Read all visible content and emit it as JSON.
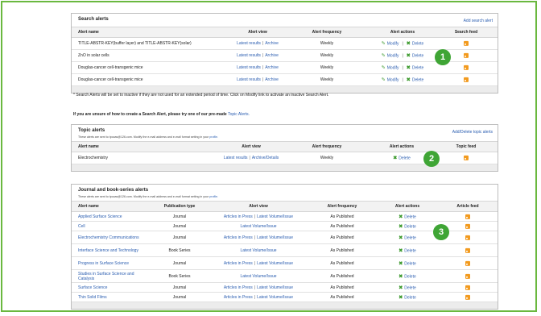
{
  "search_alerts": {
    "title": "Search alerts",
    "add_link": "Add search alert",
    "columns": [
      "Alert name",
      "Alert view",
      "Alert frequency",
      "Alert actions",
      "Search feed"
    ],
    "rows": [
      {
        "name": "TITLE-ABSTR-KEY(buffer layer) and TITLE-ABSTR-KEY(solar)",
        "frequency": "Weekly"
      },
      {
        "name": "ZnO in solar cells",
        "frequency": "Weekly"
      },
      {
        "name": "Douglas-cancer cell-transgenic mice",
        "frequency": "Weekly"
      },
      {
        "name": "Douglas-cancer cell-transgenic mice",
        "frequency": "Weekly"
      }
    ],
    "view_latest": "Latest results",
    "view_archive": "Archive",
    "modify": "Modify",
    "delete": "Delete",
    "sep": "|"
  },
  "notes": {
    "inactive": "* Search Alerts will be set to inactive if they are not used for an extended period of time. Click on Modify link to activate an Inactive Search Alert.",
    "unsure": "If you are unsure of how to create a Search Alert, please try one of our pre-made",
    "unsure_link": "Topic Alerts."
  },
  "topic_alerts": {
    "title": "Topic alerts",
    "subtitle": "These alerts are sent to tpocas@126.com. Modify the e-mail address and e-mail format setting in your",
    "subtitle_link": "profile.",
    "link": "Add/Delete topic alerts",
    "columns": [
      "Alert name",
      "Alert view",
      "Alert frequency",
      "Alert actions",
      "Topic feed"
    ],
    "rows": [
      {
        "name": "Electrochemistry",
        "view_a": "Latest results",
        "view_b": "Archive/Details",
        "frequency": "Weekly"
      }
    ],
    "delete": "Delete",
    "sep": "|"
  },
  "journal_alerts": {
    "title": "Journal and book-series alerts",
    "subtitle": "These alerts are sent to tpocas@126.com. Modify the e-mail address and e-mail format setting in your",
    "subtitle_link": "profile.",
    "columns": [
      "Alert name",
      "Publication type",
      "Alert view",
      "Alert frequency",
      "Alert actions",
      "Article feed"
    ],
    "rows": [
      {
        "name": "Applied Surface Science",
        "type": "Journal",
        "view": "both",
        "frequency": "As Published"
      },
      {
        "name": "Cell",
        "type": "Journal",
        "view": "latest",
        "frequency": "As Published"
      },
      {
        "name": "Electrochemistry Communications",
        "type": "Journal",
        "view": "both",
        "frequency": "As Published"
      },
      {
        "name": "Interface Science and Technology",
        "type": "Book Series",
        "view": "latest",
        "frequency": "As Published"
      },
      {
        "name": "Progress in Surface Science",
        "type": "Journal",
        "view": "both",
        "frequency": "As Published"
      },
      {
        "name": "Studies in Surface Science and Catalysis",
        "type": "Book Series",
        "view": "latest",
        "frequency": "As Published"
      },
      {
        "name": "Surface Science",
        "type": "Journal",
        "view": "both",
        "frequency": "As Published"
      },
      {
        "name": "Thin Solid Films",
        "type": "Journal",
        "view": "both",
        "frequency": "As Published"
      }
    ],
    "articles_in_press": "Articles in Press",
    "latest_volume": "Latest Volume/Issue",
    "delete": "Delete",
    "sep": "|"
  },
  "badges": [
    "1",
    "2",
    "3"
  ],
  "colors": {
    "frame": "#6ab83f",
    "link": "#2a5db0",
    "badge": "#3fa535",
    "rss": "#f29a1e"
  }
}
